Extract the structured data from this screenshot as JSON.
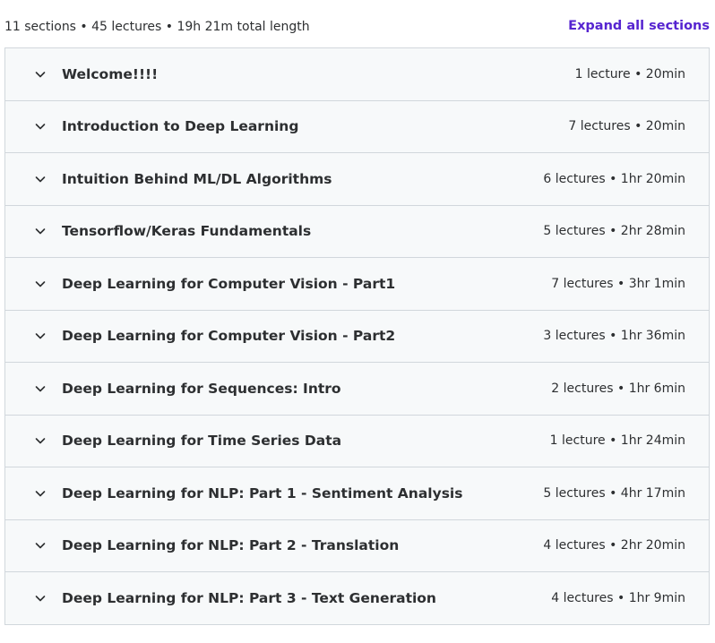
{
  "summary": {
    "text": "11 sections • 45 lectures • 19h 21m total length",
    "expand_all_label": "Expand all sections"
  },
  "icons": {
    "section_toggle": "chevron-down-icon"
  },
  "colors": {
    "accent": "#5624d0",
    "row_background": "#f7f9fa",
    "border": "#d1d7dc",
    "text": "#2d2f31"
  },
  "sections": [
    {
      "title": "Welcome!!!!",
      "meta": "1 lecture • 20min"
    },
    {
      "title": "Introduction to Deep Learning",
      "meta": "7 lectures • 20min"
    },
    {
      "title": "Intuition Behind ML/DL Algorithms",
      "meta": "6 lectures • 1hr 20min"
    },
    {
      "title": "Tensorflow/Keras Fundamentals",
      "meta": "5 lectures • 2hr 28min"
    },
    {
      "title": "Deep Learning for Computer Vision - Part1",
      "meta": "7 lectures • 3hr 1min"
    },
    {
      "title": "Deep Learning for Computer Vision - Part2",
      "meta": "3 lectures • 1hr 36min"
    },
    {
      "title": "Deep Learning for Sequences: Intro",
      "meta": "2 lectures • 1hr 6min"
    },
    {
      "title": "Deep Learning for Time Series Data",
      "meta": "1 lecture • 1hr 24min"
    },
    {
      "title": "Deep Learning for NLP: Part 1 - Sentiment Analysis",
      "meta": "5 lectures • 4hr 17min"
    },
    {
      "title": "Deep Learning for NLP: Part 2 - Translation",
      "meta": "4 lectures • 2hr 20min"
    },
    {
      "title": "Deep Learning for NLP: Part 3 - Text Generation",
      "meta": "4 lectures • 1hr 9min"
    }
  ]
}
